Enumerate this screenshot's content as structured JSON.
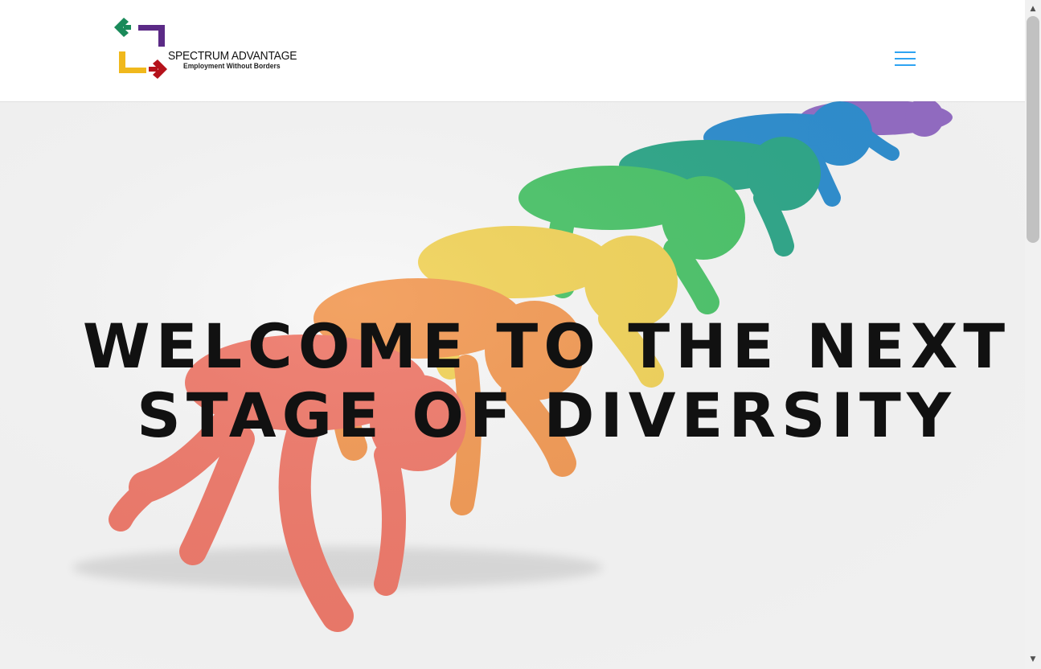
{
  "header": {
    "logo": {
      "name": "SPECTRUM ADVANTAGE",
      "tagline": "Employment Without Borders",
      "colors": [
        "#1a8a5a",
        "#5b2a86",
        "#f0b81c",
        "#b5121b"
      ]
    },
    "menu_icon": "hamburger-menu-icon",
    "accent_color": "#2ea3f2"
  },
  "hero": {
    "heading": "WELCOME TO THE NEXT STAGE OF DIVERSITY",
    "image_subject": "row of clay figures in starting position, red to purple",
    "figure_colors": [
      "#ef7a6b",
      "#f29a55",
      "#f1d35a",
      "#4cc46a",
      "#2fa88a",
      "#2f8fd0",
      "#8a5fc0"
    ]
  },
  "scrollbar": {
    "up_icon": "▲",
    "down_icon": "▼"
  }
}
